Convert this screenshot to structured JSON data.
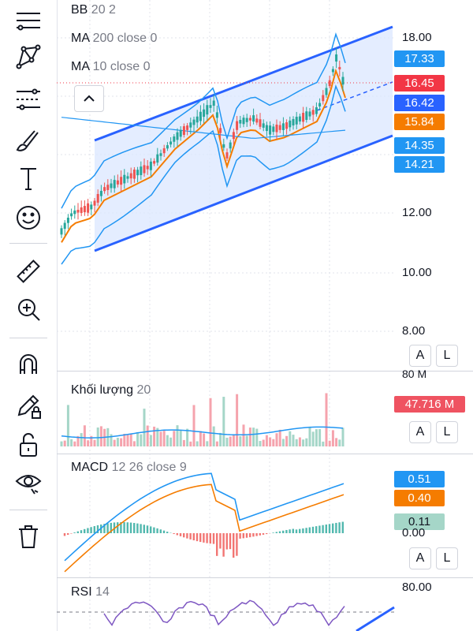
{
  "toolbar": {
    "tools": [
      {
        "icon": "crosshair-lines-icon"
      },
      {
        "icon": "pattern-tool-icon"
      },
      {
        "icon": "trend-line-tool-icon"
      },
      {
        "icon": "brush-icon"
      },
      {
        "icon": "text-tool-icon"
      },
      {
        "icon": "emoji-icon"
      },
      {
        "icon": "ruler-icon"
      },
      {
        "icon": "zoom-in-icon"
      },
      {
        "icon": "magnet-icon"
      },
      {
        "icon": "lock-drawing-pencil-icon"
      },
      {
        "icon": "unlock-icon"
      },
      {
        "icon": "eye-icon"
      },
      {
        "icon": "trash-icon"
      }
    ]
  },
  "legend": {
    "bb": {
      "name": "BB",
      "params": "20 2"
    },
    "ma200": {
      "name": "MA",
      "params": "200 close 0"
    },
    "ma10": {
      "name": "MA",
      "params": "10 close 0"
    },
    "volume": {
      "name": "Khối lượng",
      "params": "20"
    },
    "macd": {
      "name": "MACD",
      "params": "12 26 close 9"
    },
    "rsi": {
      "name": "RSI",
      "params": "14"
    }
  },
  "price_axis": {
    "ticks": [
      "18.00",
      "12.00",
      "10.00",
      "8.00"
    ],
    "labels": [
      {
        "value": "17.33",
        "color": "#2196f3"
      },
      {
        "value": "16.45",
        "color": "#f23645"
      },
      {
        "value": "16.42",
        "color": "#2962ff"
      },
      {
        "value": "15.84",
        "color": "#f57c00"
      },
      {
        "value": "14.35",
        "color": "#2196f3"
      },
      {
        "value": "14.21",
        "color": "#2196f3"
      }
    ]
  },
  "volume_axis": {
    "tick": "80 M",
    "label": {
      "value": "47.716 M",
      "color": "#ef5361"
    }
  },
  "macd_axis": {
    "tick": "0.00",
    "labels": [
      {
        "value": "0.51",
        "color": "#2196f3"
      },
      {
        "value": "0.40",
        "color": "#f57c00"
      },
      {
        "value": "0.11",
        "color": "#a5d6c8"
      }
    ]
  },
  "rsi_axis": {
    "tick": "80.00"
  },
  "buttons": {
    "a": "A",
    "l": "L"
  },
  "colors": {
    "up": "#26a69a",
    "down": "#ef5350",
    "bb": "#2196f3",
    "ma": "#f57c00",
    "channel": "#2962ff",
    "fill": "#dbe7ff"
  }
}
